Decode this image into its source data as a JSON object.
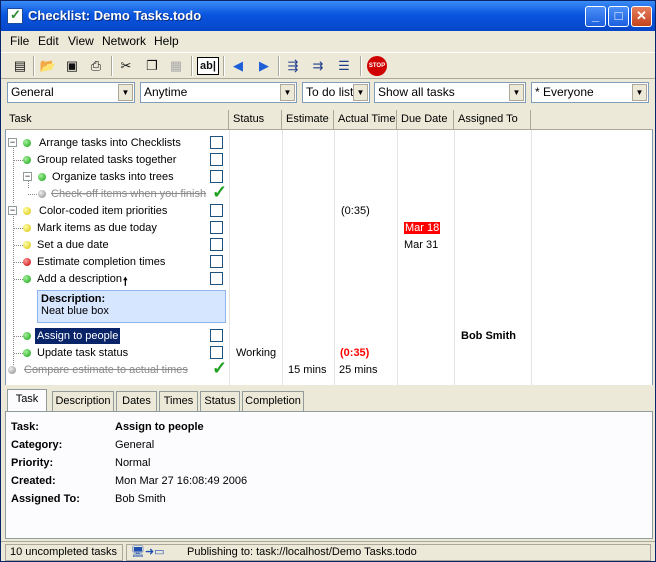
{
  "window": {
    "title": "Checklist: Demo Tasks.todo",
    "min": "_",
    "max": "□",
    "close": "✕"
  },
  "menu": [
    "File",
    "Edit",
    "View",
    "Network",
    "Help"
  ],
  "toolbar": {
    "icons": [
      "new-file-icon",
      "open-folder-icon",
      "save-icon",
      "print-icon",
      "cut-icon",
      "copy-icon",
      "paste-icon",
      "rename-icon",
      "arrow-left-icon",
      "arrow-right-icon",
      "add-sibling-icon",
      "add-child-icon",
      "list-icon",
      "stop-icon"
    ],
    "rename_label": "ab|",
    "stop_label": "STOP"
  },
  "filters": {
    "category": "General",
    "time": "Anytime",
    "list": "To do list",
    "show": "Show all tasks",
    "assignee": "* Everyone"
  },
  "columns": [
    "Task",
    "Status",
    "Estimate",
    "Actual Time",
    "Due Date",
    "Assigned To"
  ],
  "tasks": [
    {
      "label": "Arrange tasks into Checklists",
      "dot": "green",
      "status": "",
      "estimate": "",
      "actual": "",
      "due": "",
      "assigned": ""
    },
    {
      "label": "Group related tasks together",
      "dot": "green",
      "status": "",
      "estimate": "",
      "actual": "",
      "due": "",
      "assigned": ""
    },
    {
      "label": "Organize tasks into trees",
      "dot": "green",
      "status": "",
      "estimate": "",
      "actual": "",
      "due": "",
      "assigned": ""
    },
    {
      "label": "Check-off items when you finish",
      "dot": "grey",
      "status": "",
      "estimate": "",
      "actual": "",
      "due": "",
      "assigned": ""
    },
    {
      "label": "Color-coded item priorities",
      "dot": "yellow",
      "status": "",
      "estimate": "",
      "actual": "(0:35)",
      "due": "",
      "assigned": ""
    },
    {
      "label": "Mark items as due today",
      "dot": "yellow",
      "status": "",
      "estimate": "",
      "actual": "",
      "due": "Mar 18",
      "assigned": ""
    },
    {
      "label": "Set a due date",
      "dot": "yellow",
      "status": "",
      "estimate": "",
      "actual": "",
      "due": "Mar 31",
      "assigned": ""
    },
    {
      "label": "Estimate completion times",
      "dot": "red",
      "status": "",
      "estimate": "",
      "actual": "",
      "due": "",
      "assigned": ""
    },
    {
      "label": "Add a description",
      "dot": "green",
      "status": "",
      "estimate": "",
      "actual": "",
      "due": "",
      "assigned": ""
    },
    {
      "label": "Assign to people",
      "dot": "green",
      "status": "",
      "estimate": "",
      "actual": "",
      "due": "",
      "assigned": "Bob Smith"
    },
    {
      "label": "Update task status",
      "dot": "green",
      "status": "Working",
      "estimate": "",
      "actual": "(0:35)",
      "due": "",
      "assigned": ""
    },
    {
      "label": "Compare estimate to actual times",
      "dot": "grey",
      "status": "",
      "estimate": "15 mins",
      "actual": "25 mins",
      "due": "",
      "assigned": ""
    }
  ],
  "add_description_arrow": "🠕",
  "description": {
    "heading": "Description:",
    "text": "Neat blue box"
  },
  "detail_tabs": [
    "Task",
    "Description",
    "Dates",
    "Times",
    "Status",
    "Completion"
  ],
  "details": {
    "task_label": "Task:",
    "task": "Assign to people",
    "category_label": "Category:",
    "category": "General",
    "priority_label": "Priority:",
    "priority": "Normal",
    "created_label": "Created:",
    "created": "Mon Mar 27 16:08:49 2006",
    "assigned_label": "Assigned To:",
    "assigned": "Bob Smith"
  },
  "status": {
    "count": "10 uncompleted tasks",
    "publishing": "Publishing to: task://localhost/Demo Tasks.todo"
  },
  "colors": {
    "overdue": "#ff0000",
    "titlebar": "#0a55e0",
    "description_bg": "#d6e6ff"
  }
}
